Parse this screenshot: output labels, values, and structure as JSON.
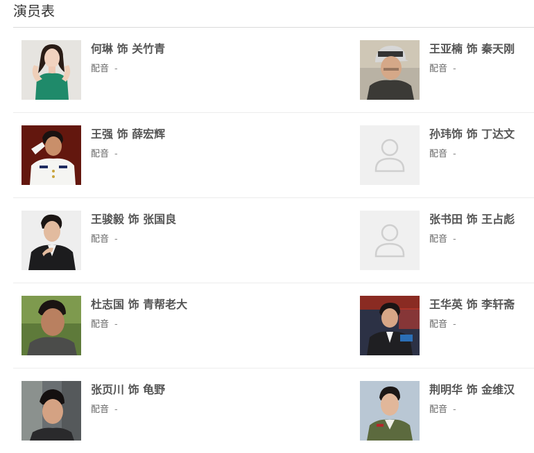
{
  "section": {
    "title": "演员表"
  },
  "cast": [
    {
      "actor": "何琳 饰 关竹青",
      "voice_label": "配音",
      "voice_value": "-",
      "photo": "photo",
      "tone": "green-dress"
    },
    {
      "actor": "王亚楠 饰 秦天刚",
      "voice_label": "配音",
      "voice_value": "-",
      "photo": "photo",
      "tone": "cap-man"
    },
    {
      "actor": "王强 饰 薛宏辉",
      "voice_label": "配音",
      "voice_value": "-",
      "photo": "photo",
      "tone": "navy-uniform"
    },
    {
      "actor": "孙玮饰 饰 丁达文",
      "voice_label": "配音",
      "voice_value": "-",
      "photo": "placeholder",
      "tone": "placeholder"
    },
    {
      "actor": "王骏毅 饰 张国良",
      "voice_label": "配音",
      "voice_value": "-",
      "photo": "photo",
      "tone": "suit-man"
    },
    {
      "actor": "张书田 饰 王占彪",
      "voice_label": "配音",
      "voice_value": "-",
      "photo": "placeholder",
      "tone": "placeholder"
    },
    {
      "actor": "杜志国 饰 青帮老大",
      "voice_label": "配音",
      "voice_value": "-",
      "photo": "photo",
      "tone": "older-man"
    },
    {
      "actor": "王华英 饰 李轩斋",
      "voice_label": "配音",
      "voice_value": "-",
      "photo": "photo",
      "tone": "tv-man"
    },
    {
      "actor": "张页川 饰 龟野",
      "voice_label": "配音",
      "voice_value": "-",
      "photo": "photo",
      "tone": "young-man"
    },
    {
      "actor": "荆明华 饰 金维汉",
      "voice_label": "配音",
      "voice_value": "-",
      "photo": "photo",
      "tone": "uniform-man"
    }
  ]
}
